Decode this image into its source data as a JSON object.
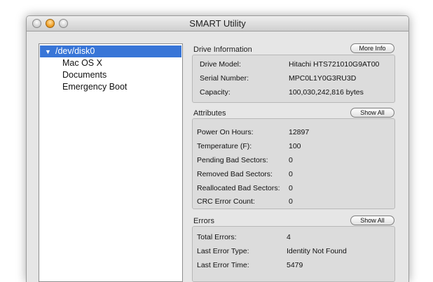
{
  "window": {
    "title": "SMART Utility"
  },
  "sidebar": {
    "items": [
      {
        "label": "/dev/disk0",
        "selected": true
      },
      {
        "label": "Mac OS X"
      },
      {
        "label": "Documents"
      },
      {
        "label": "Emergency Boot"
      }
    ]
  },
  "drive_information": {
    "heading": "Drive Information",
    "button_label": "More Info",
    "rows": [
      {
        "label": "Drive Model:",
        "value": "Hitachi HTS721010G9AT00"
      },
      {
        "label": "Serial Number:",
        "value": "MPC0L1Y0G3RU3D"
      },
      {
        "label": "Capacity:",
        "value": "100,030,242,816 bytes"
      }
    ]
  },
  "attributes": {
    "heading": "Attributes",
    "button_label": "Show All",
    "rows": [
      {
        "label": "Power On Hours:",
        "value": "12897"
      },
      {
        "label": "Temperature (F):",
        "value": "100"
      },
      {
        "label": "Pending Bad Sectors:",
        "value": "0"
      },
      {
        "label": "Removed Bad Sectors:",
        "value": "0"
      },
      {
        "label": "Reallocated Bad Sectors:",
        "value": "0"
      },
      {
        "label": "CRC Error Count:",
        "value": "0"
      }
    ]
  },
  "errors": {
    "heading": "Errors",
    "button_label": "Show All",
    "rows": [
      {
        "label": "Total Errors:",
        "value": "4"
      },
      {
        "label": "Last Error Type:",
        "value": "Identity Not Found"
      },
      {
        "label": "Last Error Time:",
        "value": "5479"
      }
    ]
  },
  "colors": {
    "selection": "#3875d7",
    "window_bg": "#e6e6e6",
    "group_bg": "#dcdcdc"
  }
}
